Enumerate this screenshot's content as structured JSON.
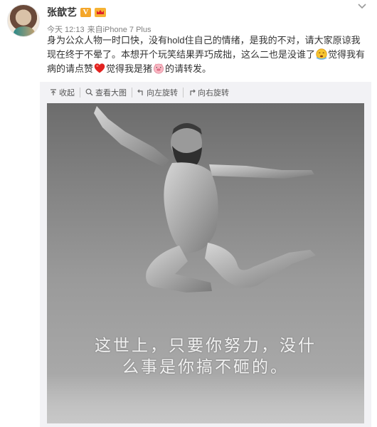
{
  "post": {
    "author": "张歆艺",
    "vip_badge": "V",
    "time": "今天 12:13",
    "source_prefix": "来自",
    "device": "iPhone 7 Plus",
    "text": {
      "part1": "身为公众人物一时口快，没有hold住自己的情绪，是我的不对，请大家原谅我现在终于不晕了。本想开个玩笑结果弄巧成拙，这么二也是没谁了",
      "part2": "觉得我有病的请点赞",
      "part3": "觉得我是猪",
      "part4": "的请转发。"
    }
  },
  "media_toolbar": {
    "collapse": "收起",
    "view_large": "查看大图",
    "rotate_left": "向左旋转",
    "rotate_right": "向右旋转"
  },
  "photo": {
    "caption_line1": "这世上，只要你努力，没什",
    "caption_line2": "么事是你搞不砸的。"
  },
  "icons": {
    "menu": "chevron-down-icon",
    "membership": "crown-icon",
    "emoji1": "dizzy-face-emoji",
    "emoji2": "heart-emoji",
    "emoji3": "pig-face-emoji"
  },
  "colors": {
    "vip_badge": "#f4a62a",
    "text": "#333333",
    "meta": "#808080",
    "media_bg": "#f2f2f5"
  }
}
